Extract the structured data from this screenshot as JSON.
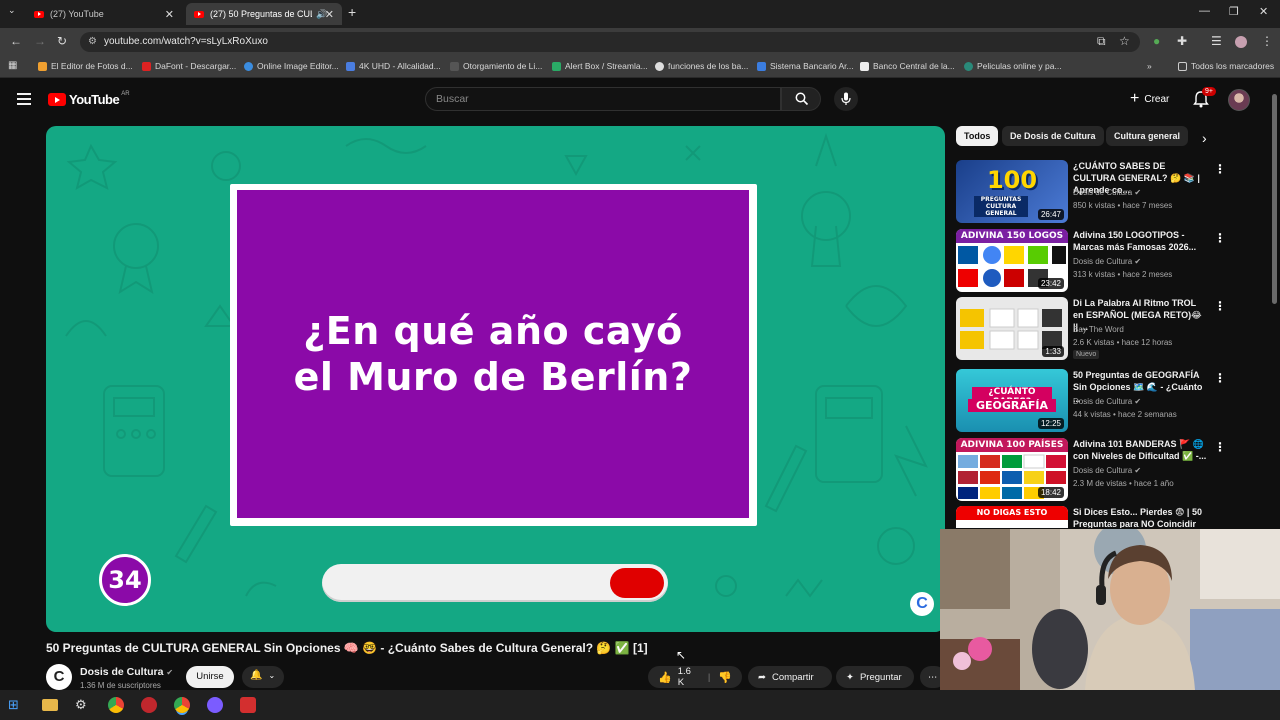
{
  "browser": {
    "tabs": [
      {
        "title": "(27) YouTube",
        "active": false
      },
      {
        "title": "(27) 50 Preguntas de CULTU",
        "active": true
      }
    ],
    "url": "youtube.com/watch?v=sLyLxRoXuxo",
    "bookmarks": [
      {
        "label": "El Editor de Fotos d...",
        "color": "#f0a030"
      },
      {
        "label": "DaFont - Descargar...",
        "color": "#d22"
      },
      {
        "label": "Online Image Editor...",
        "color": "#3b8de0"
      },
      {
        "label": "4K UHD - Allcalidad...",
        "color": "#4a7de0"
      },
      {
        "label": "Otorgamiento de Li...",
        "color": "#888"
      },
      {
        "label": "Alert Box / Streamla...",
        "color": "#2aaa66"
      },
      {
        "label": "funciones de los ba...",
        "color": "#ddd"
      },
      {
        "label": "Sistema Bancario Ar...",
        "color": "#3b7de0"
      },
      {
        "label": "Banco Central de la...",
        "color": "#eee"
      },
      {
        "label": "Peliculas online y pa...",
        "color": "#2a8a7a"
      }
    ],
    "all_bookmarks": "Todos los marcadores"
  },
  "youtube": {
    "logo": "YouTube",
    "region": "AR",
    "search_placeholder": "Buscar",
    "create_label": "Crear",
    "notifications": "9+"
  },
  "video": {
    "question": "¿En qué año cayó el Muro de Berlín?",
    "question_line1": "¿En qué año cayó",
    "question_line2": "el Muro de Berlín?",
    "question_number": "34",
    "timer_remaining_fraction": 0.16,
    "title": "50 Preguntas de CULTURA GENERAL Sin Opciones 🧠 🤓 - ¿Cuánto Sabes de Cultura General? 🤔 ✅ [1]",
    "channel": "Dosis de Cultura",
    "subscribers": "1.36 M de suscriptores",
    "join_label": "Unirse",
    "likes": "1.6 K",
    "share_label": "Compartir",
    "ask_label": "Preguntar"
  },
  "sidebar": {
    "chips": [
      "Todos",
      "De Dosis de Cultura",
      "Cultura general"
    ],
    "recommendations": [
      {
        "title": "¿CUÁNTO SABES DE CULTURA GENERAL? 🤔 📚 | Aprende co...",
        "channel": "Dosis de Cultura",
        "meta": "850 k vistas • hace 7 meses",
        "duration": "26:47",
        "thumb_text": "100",
        "thumb_sub": "PREGUNTAS CULTURA GENERAL"
      },
      {
        "title": "Adivina 150 LOGOTIPOS - Marcas más Famosas 2026...",
        "channel": "Dosis de Cultura",
        "meta": "313 k vistas • hace 2 meses",
        "duration": "23:42",
        "thumb_text": "ADIVINA 150 LOGOS"
      },
      {
        "title": "Di La Palabra Al Ritmo TROL en ESPAÑOL (MEGA RETO)😂 || ...",
        "channel": "Say The Word",
        "meta": "2.6 K vistas • hace 12 horas",
        "duration": "1:33",
        "badge": "Nuevo"
      },
      {
        "title": "50 Preguntas de GEOGRAFÍA Sin Opciones 🗺️ 🌊 - ¿Cuánto ...",
        "channel": "Dosis de Cultura",
        "meta": "44 k vistas • hace 2 semanas",
        "duration": "12:25",
        "thumb_text": "¿CUÁNTO SABES?",
        "thumb_sub": "GEOGRAFÍA"
      },
      {
        "title": "Adivina 101 BANDERAS 🚩 🌐 con Niveles de Dificultad ✅ -...",
        "channel": "Dosis de Cultura",
        "meta": "2.3 M de vistas • hace 1 año",
        "duration": "18:42",
        "thumb_text": "ADIVINA 100 PAÍSES"
      },
      {
        "title": "Si Dices Esto... Pierdes 😨 | 50 Preguntas para NO Coincidir",
        "channel": "",
        "meta": "",
        "duration": "",
        "thumb_text": "NO DIGAS ESTO"
      }
    ]
  },
  "colors": {
    "player_bg": "#14a884",
    "card_purple": "#8b0aa8",
    "timer_red": "#e00000",
    "yt_red": "#ff0000"
  }
}
